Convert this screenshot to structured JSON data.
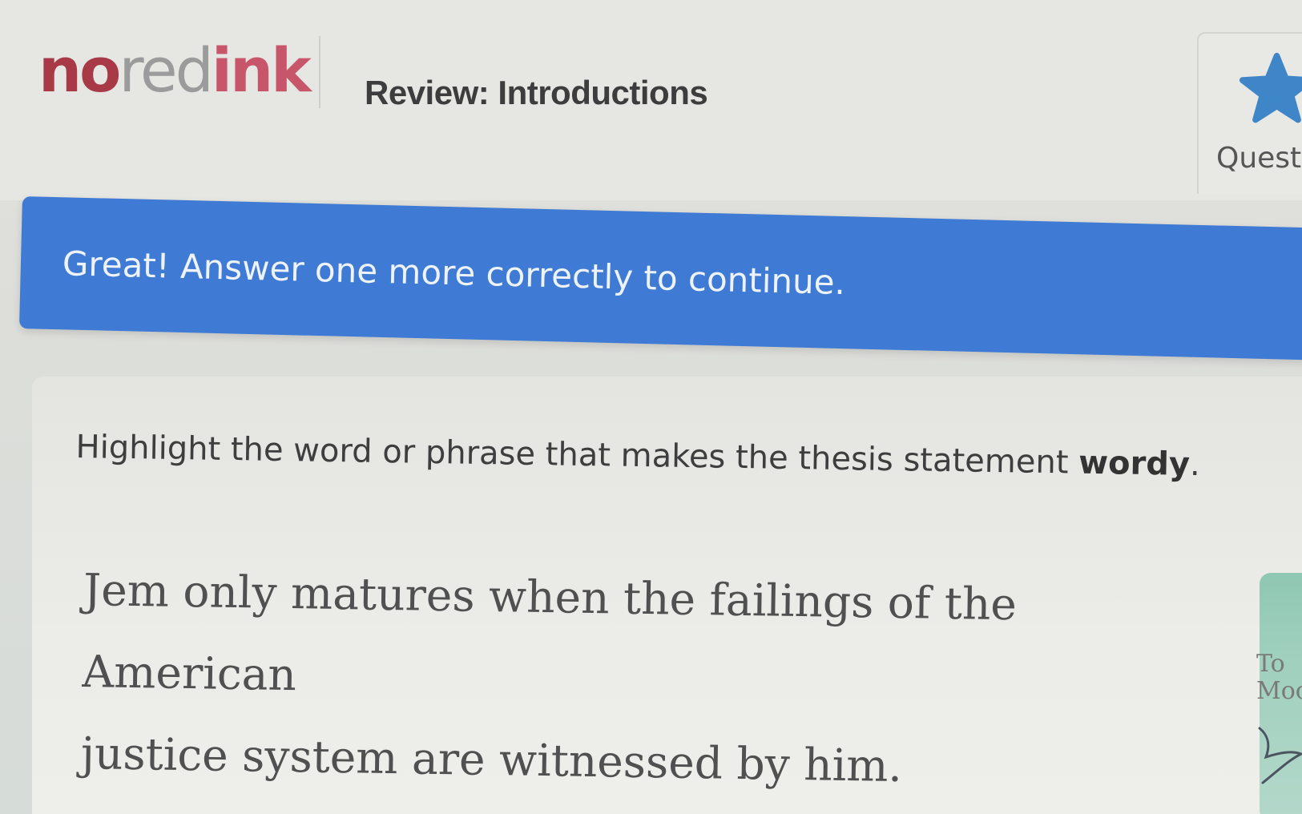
{
  "header": {
    "logo": {
      "part1": "no",
      "part2": "red",
      "part3": "ink"
    },
    "activity_title": "Review: Introductions",
    "progress": {
      "icon": "star-icon",
      "label": "Questi"
    }
  },
  "banner": {
    "message": "Great! Answer one more correctly to continue."
  },
  "question": {
    "instruction_prefix": "Highlight the word or phrase that makes the thesis statement ",
    "instruction_emphasis": "wordy",
    "instruction_suffix": ".",
    "sentence_words": [
      "Jem",
      "only",
      "matures",
      "when",
      "the",
      "failings",
      "of",
      "the",
      "American",
      "justice",
      "system",
      "are",
      "witnessed",
      "by",
      "him."
    ]
  },
  "side_tool": {
    "line1": "To",
    "line2": "Moc"
  },
  "colors": {
    "banner": "#3f7bd4",
    "logo_no": "#a83a48",
    "logo_ink": "#c8566a",
    "star": "#3f86c9",
    "side_panel": "#8ec7b2"
  }
}
